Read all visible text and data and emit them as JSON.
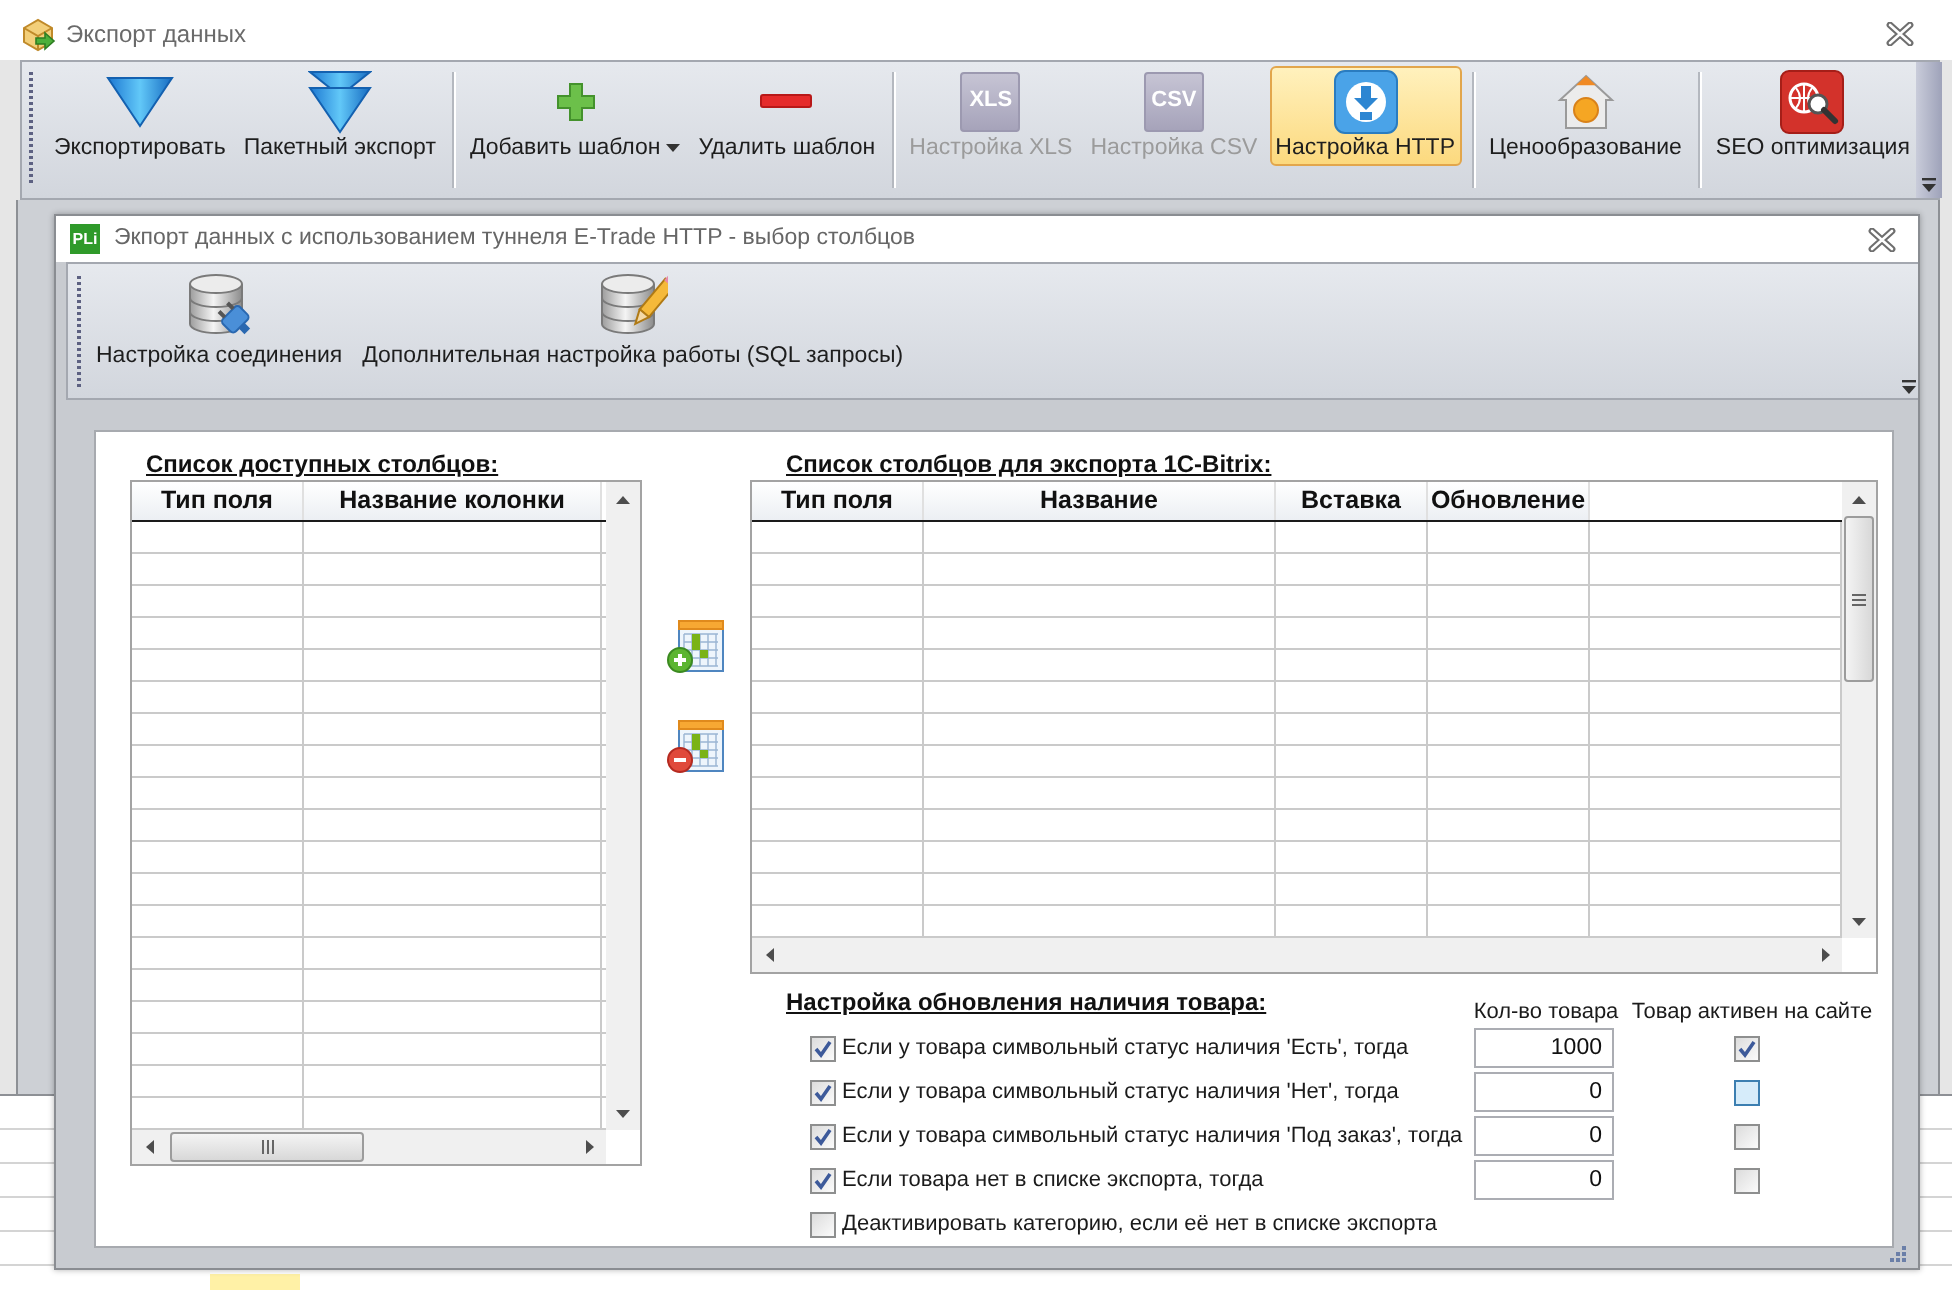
{
  "window": {
    "title": "Экспорт данных"
  },
  "toolbar": {
    "groups": [
      [
        {
          "kind": "export",
          "label": "Экспортировать",
          "has_menu": false,
          "disabled": false,
          "selected": false
        },
        {
          "kind": "batch",
          "label": "Пакетный экспорт",
          "has_menu": false,
          "disabled": false,
          "selected": false
        }
      ],
      [
        {
          "kind": "add",
          "label": "Добавить шаблон",
          "has_menu": true,
          "disabled": false,
          "selected": false
        },
        {
          "kind": "remove",
          "label": "Удалить шаблон",
          "has_menu": false,
          "disabled": false,
          "selected": false
        }
      ],
      [
        {
          "kind": "xls",
          "label": "Настройка XLS",
          "icon_text": "XLS",
          "has_menu": false,
          "disabled": true,
          "selected": false
        },
        {
          "kind": "csv",
          "label": "Настройка CSV",
          "icon_text": "CSV",
          "has_menu": false,
          "disabled": true,
          "selected": false
        },
        {
          "kind": "http",
          "label": "Настройка HTTP",
          "has_menu": false,
          "disabled": false,
          "selected": true
        }
      ],
      [
        {
          "kind": "pricing",
          "label": "Ценообразование",
          "has_menu": false,
          "disabled": false,
          "selected": false
        }
      ],
      [
        {
          "kind": "seo",
          "label": "SEO оптимизация",
          "has_menu": false,
          "disabled": false,
          "selected": false
        }
      ]
    ]
  },
  "dialog": {
    "icon_text": "PLi",
    "title": "Экпорт данных с использованием туннеля E-Trade HTTP - выбор столбцов",
    "toolbar": [
      {
        "kind": "connection",
        "label": "Настройка соединения"
      },
      {
        "kind": "sql",
        "label": "Дополнительная настройка работы (SQL запросы)"
      }
    ],
    "available_columns": {
      "title": "Список доступных столбцов:",
      "columns": [
        "Тип поля",
        "Название колонки"
      ]
    },
    "export_columns": {
      "title": "Список столбцов для экспорта 1C-Bitrix:",
      "columns": [
        "Тип поля",
        "Название",
        "Вставка",
        "Обновление"
      ]
    },
    "stock_update": {
      "title": "Настройка обновления наличия товара:",
      "headers": [
        "Кол-во товара",
        "Товар активен на сайте"
      ],
      "rows": [
        {
          "kind": "rule",
          "label": "Если у товара символьный статус наличия 'Есть', тогда",
          "checked": true,
          "quantity": "1000",
          "active": true,
          "focused": false
        },
        {
          "kind": "rule",
          "label": "Если у товара символьный статус наличия 'Нет', тогда",
          "checked": true,
          "quantity": "0",
          "active": false,
          "focused": true
        },
        {
          "kind": "rule",
          "label": "Если у товара символьный статус наличия 'Под заказ', тогда",
          "checked": true,
          "quantity": "0",
          "active": false,
          "focused": false
        },
        {
          "kind": "rule",
          "label": "Если товара нет в списке экспорта, тогда",
          "checked": true,
          "quantity": "0",
          "active": false,
          "focused": false
        },
        {
          "kind": "option",
          "label": "Деактивировать категорию, если её нет в списке экспорта",
          "checked": false
        }
      ]
    }
  }
}
